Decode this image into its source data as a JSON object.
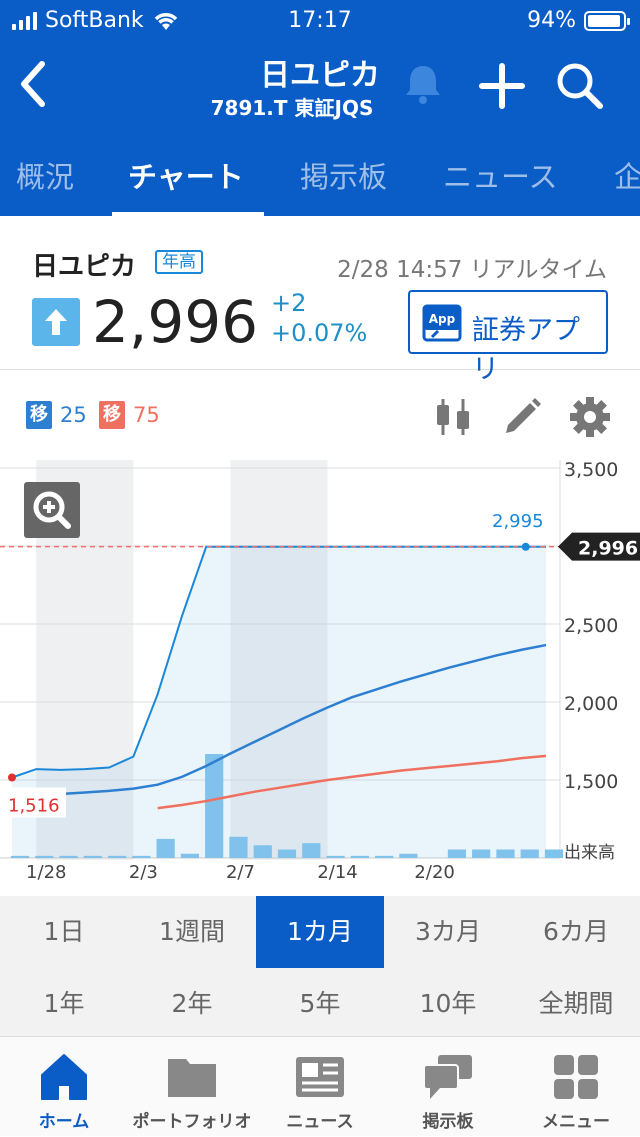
{
  "status_bar": {
    "carrier": "SoftBank",
    "time": "17:17",
    "battery": "94%"
  },
  "header": {
    "title": "日ユピカ",
    "subtitle": "7891.T 東証JQS"
  },
  "tabs": [
    {
      "label": "概況"
    },
    {
      "label": "チャート",
      "active": true
    },
    {
      "label": "掲示板"
    },
    {
      "label": "ニュース"
    },
    {
      "label": "企"
    }
  ],
  "quote": {
    "name": "日ユピカ",
    "badge": "年高",
    "timestamp": "2/28 14:57 リアルタイム",
    "price": "2,996",
    "change": "+2",
    "change_pct": "+0.07%",
    "app_button": "証券アプリ",
    "app_icon_text": "App"
  },
  "chart_tools": {
    "ma_short_tag": "移",
    "ma_short_value": "25",
    "ma_long_tag": "移",
    "ma_long_value": "75",
    "colors": {
      "ma_short": "#2d7fd2",
      "ma_long": "#f07060"
    }
  },
  "chart_data": {
    "type": "line",
    "x": [
      "1/27",
      "1/28",
      "1/29",
      "1/30",
      "1/31",
      "2/3",
      "2/4",
      "2/5",
      "2/6",
      "2/7",
      "2/10",
      "2/12",
      "2/13",
      "2/14",
      "2/17",
      "2/18",
      "2/19",
      "2/20",
      "2/21",
      "2/25",
      "2/26",
      "2/27",
      "2/28"
    ],
    "x_tick_labels": [
      "1/28",
      "2/3",
      "2/7",
      "2/14",
      "2/20"
    ],
    "x_tick_index": [
      1,
      5,
      9,
      13,
      17
    ],
    "series": [
      {
        "role": "price",
        "values": [
          1516,
          1570,
          1565,
          1570,
          1580,
          1650,
          2050,
          2550,
          2995,
          2995,
          2995,
          2995,
          2995,
          2995,
          2995,
          2995,
          2995,
          2995,
          2995,
          2995,
          2995,
          2995,
          2995
        ],
        "color": "#1a88d8"
      },
      {
        "name": "移 25",
        "values": [
          1390,
          1400,
          1410,
          1420,
          1430,
          1445,
          1470,
          1520,
          1590,
          1670,
          1745,
          1820,
          1895,
          1965,
          2030,
          2080,
          2130,
          2175,
          2220,
          2260,
          2300,
          2335,
          2365
        ],
        "color": "#2d7fd2"
      },
      {
        "name": "移 75",
        "values": [
          null,
          null,
          null,
          null,
          null,
          null,
          1320,
          1340,
          1365,
          1395,
          1425,
          1450,
          1475,
          1500,
          1520,
          1540,
          1560,
          1575,
          1590,
          1605,
          1620,
          1640,
          1655
        ],
        "color": "#f07060"
      }
    ],
    "volume": [
      1,
      1,
      1,
      1,
      1,
      1,
      9,
      2,
      49,
      10,
      6,
      4,
      7,
      1,
      1,
      1,
      2,
      0,
      4,
      4,
      4,
      4,
      4
    ],
    "volume_label": "出来高",
    "y_ticks": [
      1500,
      2000,
      2500,
      3000,
      3500
    ],
    "y_tick_labels": [
      "1,500",
      "2,000",
      "2,500",
      "3,000",
      "3,500"
    ],
    "ylim": [
      1000,
      3500
    ],
    "current_price_label": "2,996",
    "high_label": "2,995",
    "low_label": "1,516",
    "grid": true
  },
  "periods": [
    {
      "label": "1日"
    },
    {
      "label": "1週間"
    },
    {
      "label": "1カ月",
      "active": true
    },
    {
      "label": "3カ月"
    },
    {
      "label": "6カ月"
    },
    {
      "label": "1年"
    },
    {
      "label": "2年"
    },
    {
      "label": "5年"
    },
    {
      "label": "10年"
    },
    {
      "label": "全期間"
    }
  ],
  "bottom_nav": [
    {
      "label": "ホーム",
      "icon": "home-icon",
      "active": true
    },
    {
      "label": "ポートフォリオ",
      "icon": "folder-icon"
    },
    {
      "label": "ニュース",
      "icon": "news-icon"
    },
    {
      "label": "掲示板",
      "icon": "chat-icon"
    },
    {
      "label": "メニュー",
      "icon": "grid-icon"
    }
  ]
}
